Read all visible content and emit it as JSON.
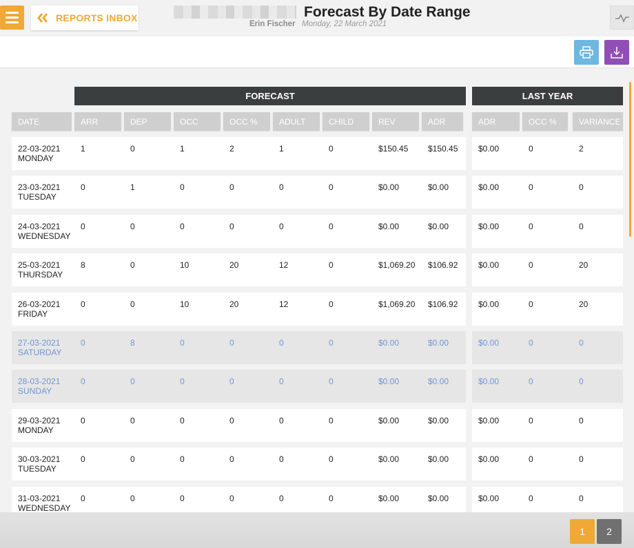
{
  "header": {
    "menu_icon": "hamburger-menu-icon",
    "back_label": "REPORTS INBOX",
    "title": "Forecast By Date Range",
    "user": "Erin Fischer",
    "date": "Monday, 22 March 2021",
    "chart_icon": "line-chart-icon"
  },
  "toolbar": {
    "print_icon": "printer-icon",
    "download_icon": "download-icon"
  },
  "table": {
    "group_forecast": "FORECAST",
    "group_last_year": "LAST YEAR",
    "columns": [
      "DATE",
      "ARR",
      "DEP",
      "OCC",
      "OCC %",
      "ADULT",
      "CHILD",
      "REV",
      "ADR",
      "ADR",
      "OCC %",
      "VARIANCE"
    ],
    "rows": [
      {
        "date": "22-03-2021",
        "day": "MONDAY",
        "weekend": false,
        "vals": [
          "1",
          "0",
          "1",
          "2",
          "1",
          "0",
          "$150.45",
          "$150.45",
          "$0.00",
          "0",
          "2"
        ]
      },
      {
        "date": "23-03-2021",
        "day": "TUESDAY",
        "weekend": false,
        "vals": [
          "0",
          "1",
          "0",
          "0",
          "0",
          "0",
          "$0.00",
          "$0.00",
          "$0.00",
          "0",
          "0"
        ]
      },
      {
        "date": "24-03-2021",
        "day": "WEDNESDAY",
        "weekend": false,
        "vals": [
          "0",
          "0",
          "0",
          "0",
          "0",
          "0",
          "$0.00",
          "$0.00",
          "$0.00",
          "0",
          "0"
        ]
      },
      {
        "date": "25-03-2021",
        "day": "THURSDAY",
        "weekend": false,
        "vals": [
          "8",
          "0",
          "10",
          "20",
          "12",
          "0",
          "$1,069.20",
          "$106.92",
          "$0.00",
          "0",
          "20"
        ]
      },
      {
        "date": "26-03-2021",
        "day": "FRIDAY",
        "weekend": false,
        "vals": [
          "0",
          "0",
          "10",
          "20",
          "12",
          "0",
          "$1,069.20",
          "$106.92",
          "$0.00",
          "0",
          "20"
        ]
      },
      {
        "date": "27-03-2021",
        "day": "SATURDAY",
        "weekend": true,
        "vals": [
          "0",
          "8",
          "0",
          "0",
          "0",
          "0",
          "$0.00",
          "$0.00",
          "$0.00",
          "0",
          "0"
        ]
      },
      {
        "date": "28-03-2021",
        "day": "SUNDAY",
        "weekend": true,
        "vals": [
          "0",
          "0",
          "0",
          "0",
          "0",
          "0",
          "$0.00",
          "$0.00",
          "$0.00",
          "0",
          "0"
        ]
      },
      {
        "date": "29-03-2021",
        "day": "MONDAY",
        "weekend": false,
        "vals": [
          "0",
          "0",
          "0",
          "0",
          "0",
          "0",
          "$0.00",
          "$0.00",
          "$0.00",
          "0",
          "0"
        ]
      },
      {
        "date": "30-03-2021",
        "day": "TUESDAY",
        "weekend": false,
        "vals": [
          "0",
          "0",
          "0",
          "0",
          "0",
          "0",
          "$0.00",
          "$0.00",
          "$0.00",
          "0",
          "0"
        ]
      },
      {
        "date": "31-03-2021",
        "day": "WEDNESDAY",
        "weekend": false,
        "vals": [
          "0",
          "0",
          "0",
          "0",
          "0",
          "0",
          "$0.00",
          "$0.00",
          "$0.00",
          "0",
          "0"
        ]
      }
    ]
  },
  "pagination": {
    "pages": [
      "1",
      "2"
    ],
    "current": "1"
  },
  "colors": {
    "accent": "#f0a836",
    "header_dark": "#3b3e41",
    "weekend_text": "#6f96d4",
    "print": "#6fb7e0",
    "download": "#8f4fb4"
  }
}
